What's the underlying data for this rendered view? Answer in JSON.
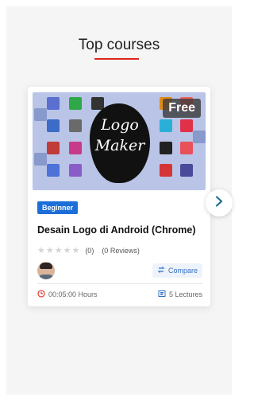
{
  "section": {
    "title": "Top courses"
  },
  "course": {
    "price_badge": "Free",
    "thumbnail_text_line1": "Logo",
    "thumbnail_text_line2": "Maker",
    "level": "Beginner",
    "title": "Desain Logo di Android (Chrome)",
    "rating_count": "(0)",
    "reviews": "(0 Reviews)",
    "compare_label": "Compare",
    "duration": "00:05:00 Hours",
    "lectures": "5 Lectures"
  },
  "colors": {
    "accent_underline": "#e0231a",
    "level_badge": "#1c6ed8",
    "compare_text": "#2f6fc2",
    "next_arrow": "#1e6f8e"
  },
  "icons": [
    "star-icon",
    "compare-icon",
    "clock-icon",
    "lectures-icon",
    "chevron-right-icon"
  ]
}
